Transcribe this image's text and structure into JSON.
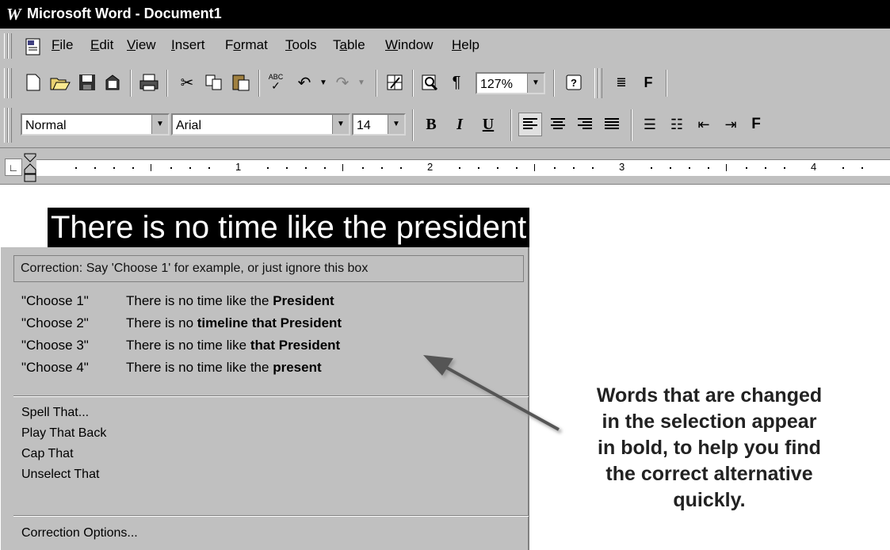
{
  "window": {
    "title": "Microsoft Word - Document1",
    "logo_letter": "W"
  },
  "menu": [
    "File",
    "Edit",
    "View",
    "Insert",
    "Format",
    "Tools",
    "Table",
    "Window",
    "Help"
  ],
  "menu_underline": [
    "F",
    "E",
    "V",
    "I",
    "o",
    "T",
    "a",
    "W",
    "H"
  ],
  "toolbar": {
    "zoom": "127%",
    "bold_glyph": "B",
    "italic_glyph": "I",
    "underline_glyph": "U",
    "f_glyph": "F"
  },
  "format": {
    "style": "Normal",
    "font": "Arial",
    "size": "14"
  },
  "ruler": {
    "numbers": [
      "1",
      "2",
      "3",
      "4"
    ]
  },
  "document": {
    "selected_text": "There is no time like the president"
  },
  "correction": {
    "header": "Correction: Say 'Choose 1' for example, or just ignore this box",
    "alternatives": [
      {
        "key": "\"Choose 1\"",
        "plain": "There is no time like the ",
        "bold": "President"
      },
      {
        "key": "\"Choose 2\"",
        "plain": "There is no ",
        "bold": "timeline that President"
      },
      {
        "key": "\"Choose 3\"",
        "plain": "There is no time like ",
        "bold": "that President"
      },
      {
        "key": "\"Choose 4\"",
        "plain": "There is no time like the ",
        "bold": "present"
      }
    ],
    "commands": [
      "Spell That...",
      "Play That Back",
      "Cap That",
      "Unselect That"
    ],
    "options": "Correction Options..."
  },
  "annotation": [
    "Words that are changed",
    "in the selection appear",
    "in bold, to help you find",
    "the correct alternative",
    "quickly."
  ]
}
